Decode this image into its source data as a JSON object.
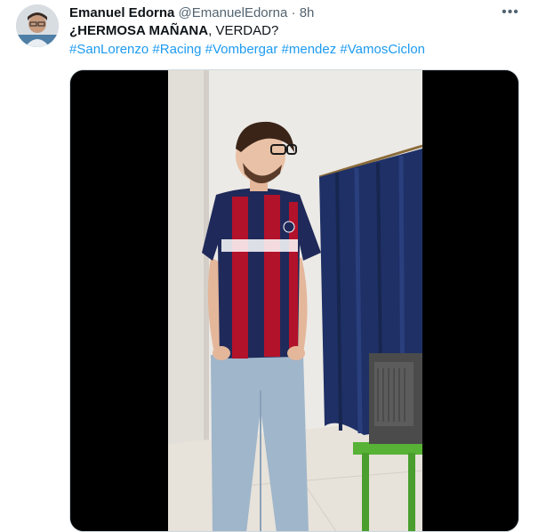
{
  "tweet": {
    "author_name": "Emanuel Edorna",
    "author_handle": "@EmanuelEdorna",
    "separator": "·",
    "time": "8h",
    "more_icon": "more-icon",
    "text_part1": "¿HERMOSA MAÑANA",
    "text_part2": ", VERDAD?",
    "hashtags": [
      "#SanLorenzo",
      "#Racing",
      "#Vombergar",
      "#mendez",
      "#VamosCiclon"
    ]
  },
  "colors": {
    "link": "#1d9bf0",
    "secondary_text": "#536471",
    "primary_text": "#0f1419",
    "jersey_red": "#b3122b",
    "jersey_blue": "#1f2a5a",
    "curtain": "#1e3066"
  }
}
